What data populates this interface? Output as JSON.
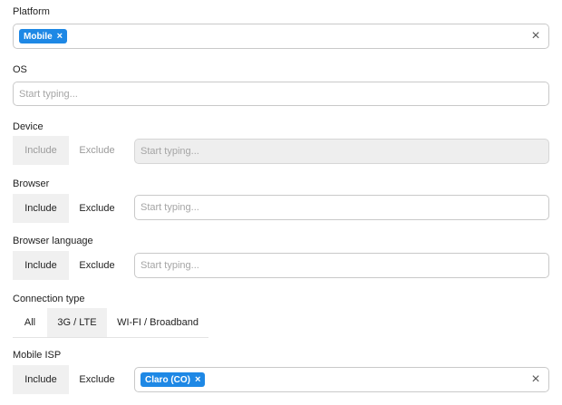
{
  "platform": {
    "label": "Platform",
    "chips": [
      {
        "text": "Mobile",
        "remove": "×"
      }
    ],
    "clear": "×"
  },
  "os": {
    "label": "OS",
    "placeholder": "Start typing..."
  },
  "device": {
    "label": "Device",
    "include": "Include",
    "exclude": "Exclude",
    "placeholder": "Start typing..."
  },
  "browser": {
    "label": "Browser",
    "include": "Include",
    "exclude": "Exclude",
    "placeholder": "Start typing..."
  },
  "browser_language": {
    "label": "Browser language",
    "include": "Include",
    "exclude": "Exclude",
    "placeholder": "Start typing..."
  },
  "connection_type": {
    "label": "Connection type",
    "options": [
      "All",
      "3G / LTE",
      "WI-FI / Broadband"
    ],
    "selected": "3G / LTE"
  },
  "mobile_isp": {
    "label": "Mobile ISP",
    "include": "Include",
    "exclude": "Exclude",
    "chips": [
      {
        "text": "Claro (CO)",
        "remove": "×"
      }
    ],
    "clear": "×"
  },
  "colors": {
    "chip": "#1e88e5",
    "active_segment": "#f0f0f0",
    "disabled_field": "#eeeeee"
  }
}
